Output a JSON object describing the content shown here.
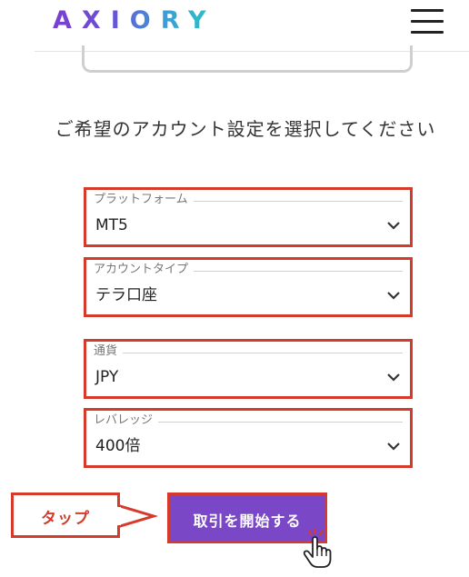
{
  "header": {
    "logo_text": "AXIORY",
    "menu_icon": "hamburger-menu-icon"
  },
  "main": {
    "heading": "ご希望のアカウント設定を選択してください",
    "fields": [
      {
        "label": "プラットフォーム",
        "value": "MT5"
      },
      {
        "label": "アカウントタイプ",
        "value": "テラ口座"
      },
      {
        "label": "通貨",
        "value": "JPY"
      },
      {
        "label": "レバレッジ",
        "value": "400倍"
      }
    ],
    "start_button": "取引を開始する"
  },
  "annotation": {
    "callout_text": "タップ",
    "accent_color": "#d53a2a",
    "button_color": "#7a48c6",
    "pointer_icon": "hand-pointer-icon"
  }
}
